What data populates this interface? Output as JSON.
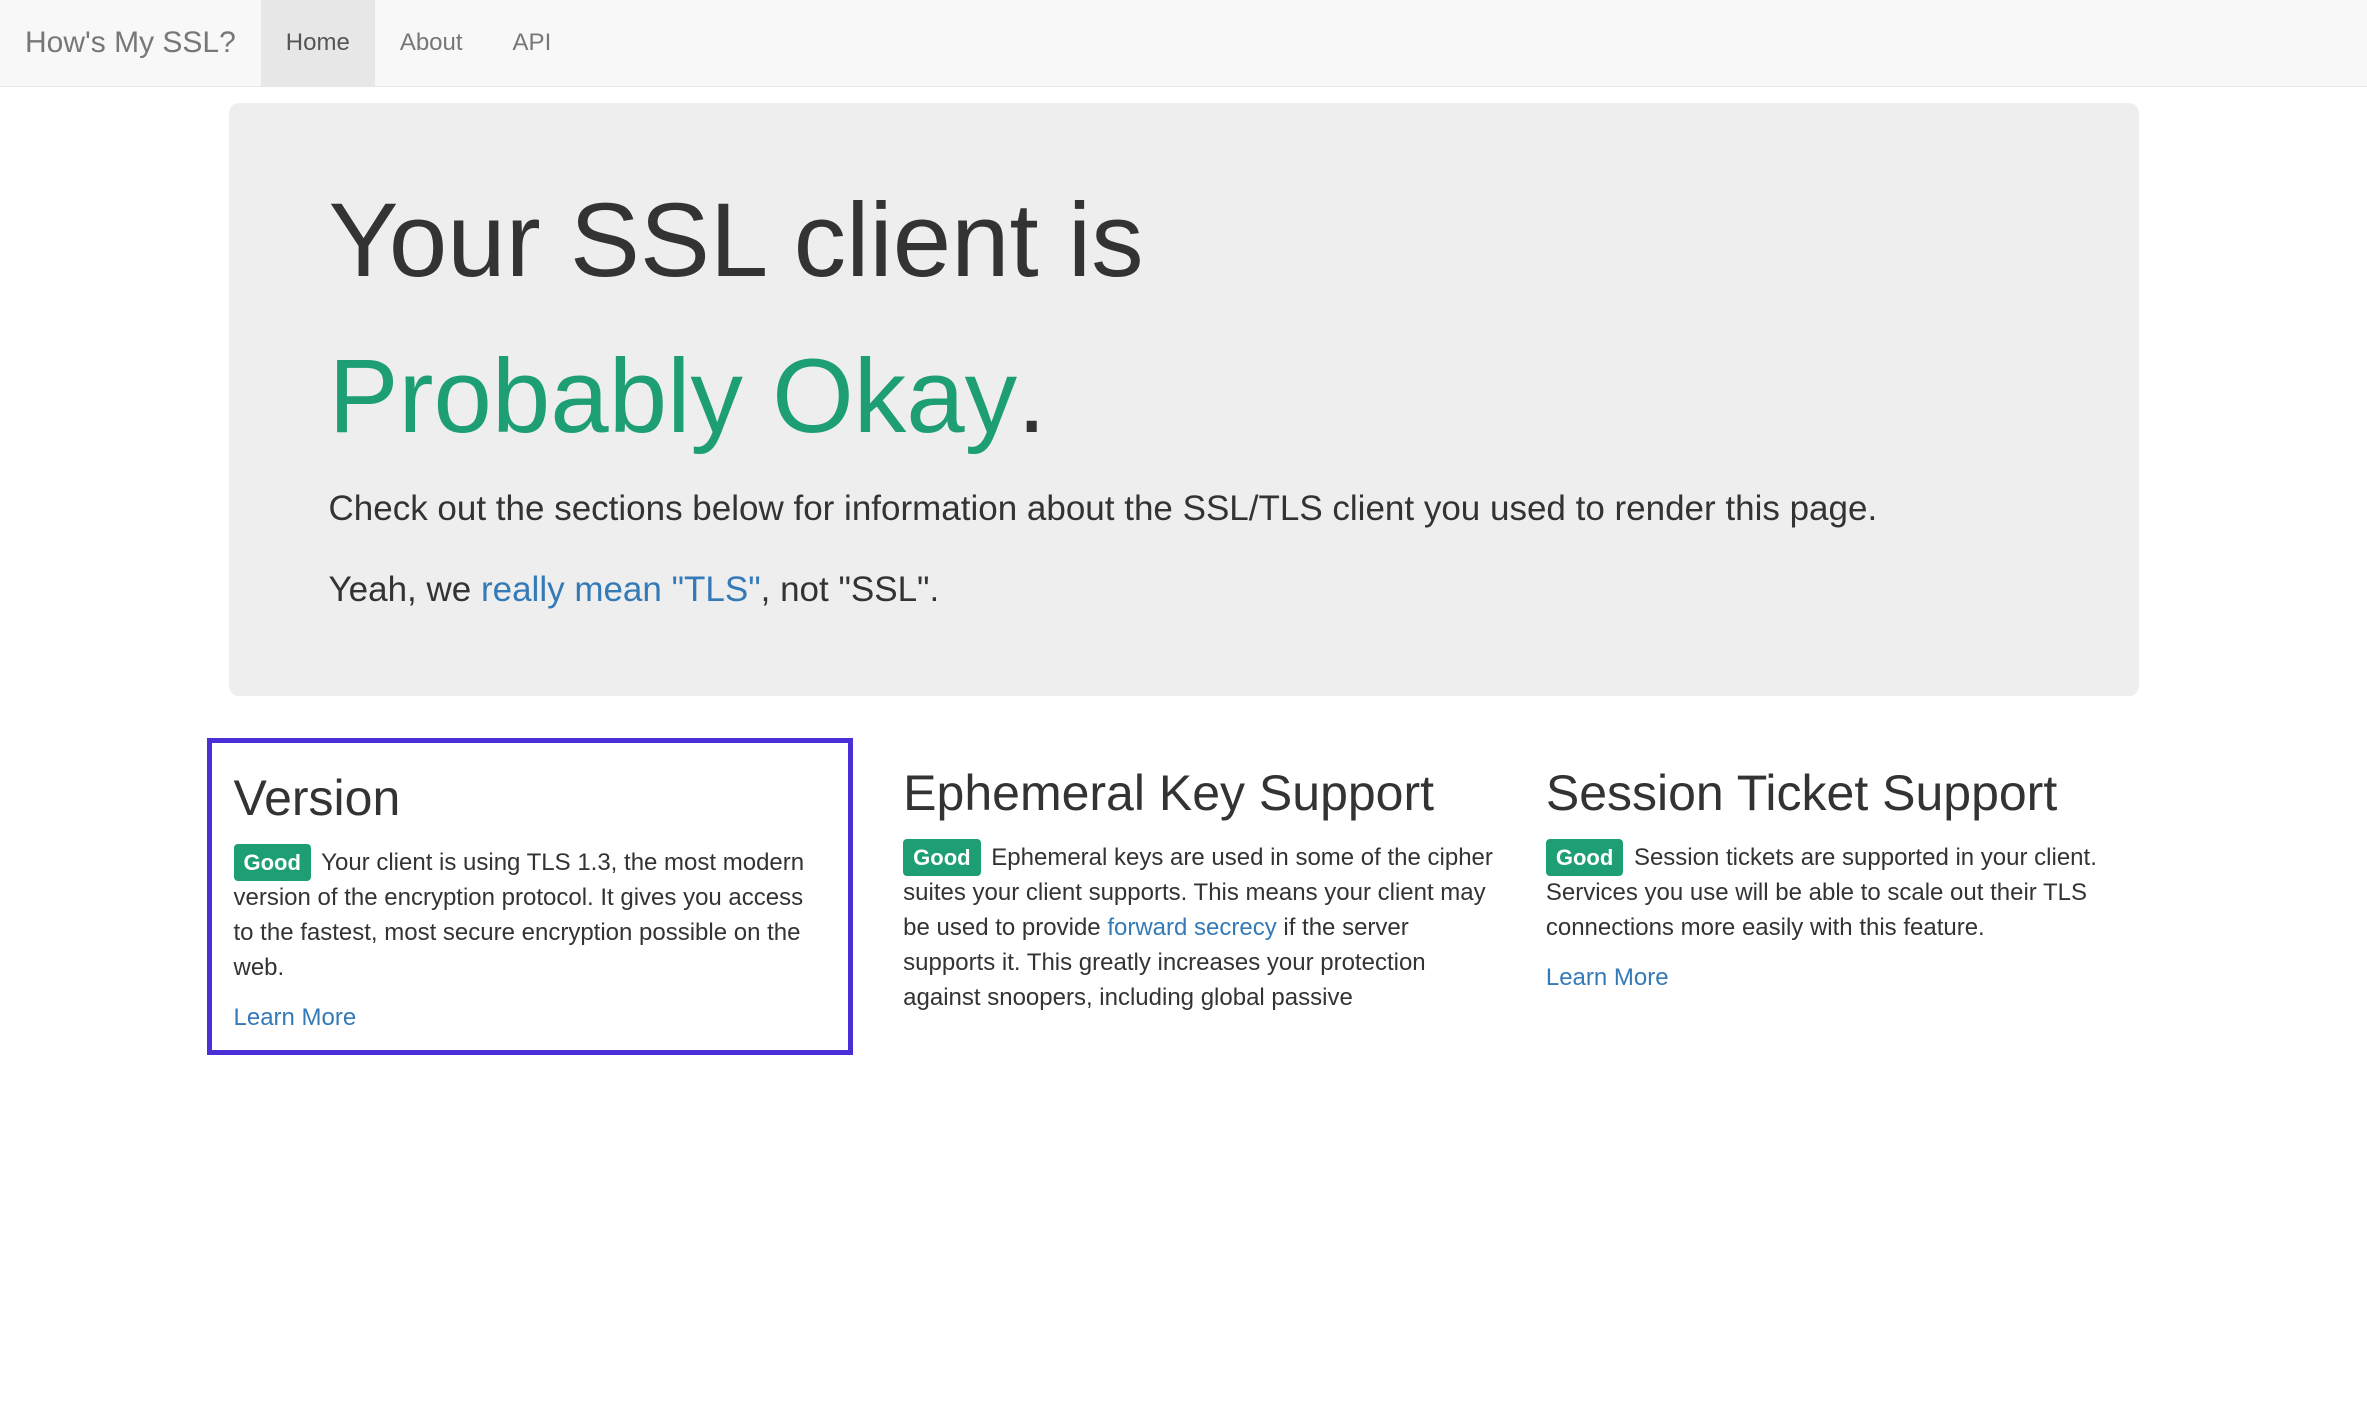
{
  "nav": {
    "brand": "How's My SSL?",
    "items": [
      {
        "label": "Home",
        "active": true
      },
      {
        "label": "About",
        "active": false
      },
      {
        "label": "API",
        "active": false
      }
    ]
  },
  "jumbo": {
    "headline_prefix": "Your SSL client is ",
    "headline_status": "Probably Okay",
    "headline_suffix": ".",
    "lead": "Check out the sections below for information about the SSL/TLS client you used to render this page.",
    "p2_pre": "Yeah, we ",
    "p2_link": "really mean \"TLS\"",
    "p2_post": ", not \"SSL\"."
  },
  "sections": {
    "version": {
      "title": "Version",
      "badge": "Good",
      "text": "Your client is using TLS 1.3, the most modern version of the encryption protocol. It gives you access to the fastest, most secure encryption possible on the web.",
      "learn_more": "Learn More"
    },
    "ephemeral": {
      "title": "Ephemeral Key Support",
      "badge": "Good",
      "text_pre": "Ephemeral keys are used in some of the cipher suites your client supports. This means your client may be used to provide ",
      "link": "forward secrecy",
      "text_post": " if the server supports it. This greatly increases your protection against snoopers, including global passive"
    },
    "ticket": {
      "title": "Session Ticket Support",
      "badge": "Good",
      "text": "Session tickets are supported in your client. Services you use will be able to scale out their TLS connections more easily with this feature.",
      "learn_more": "Learn More"
    }
  }
}
